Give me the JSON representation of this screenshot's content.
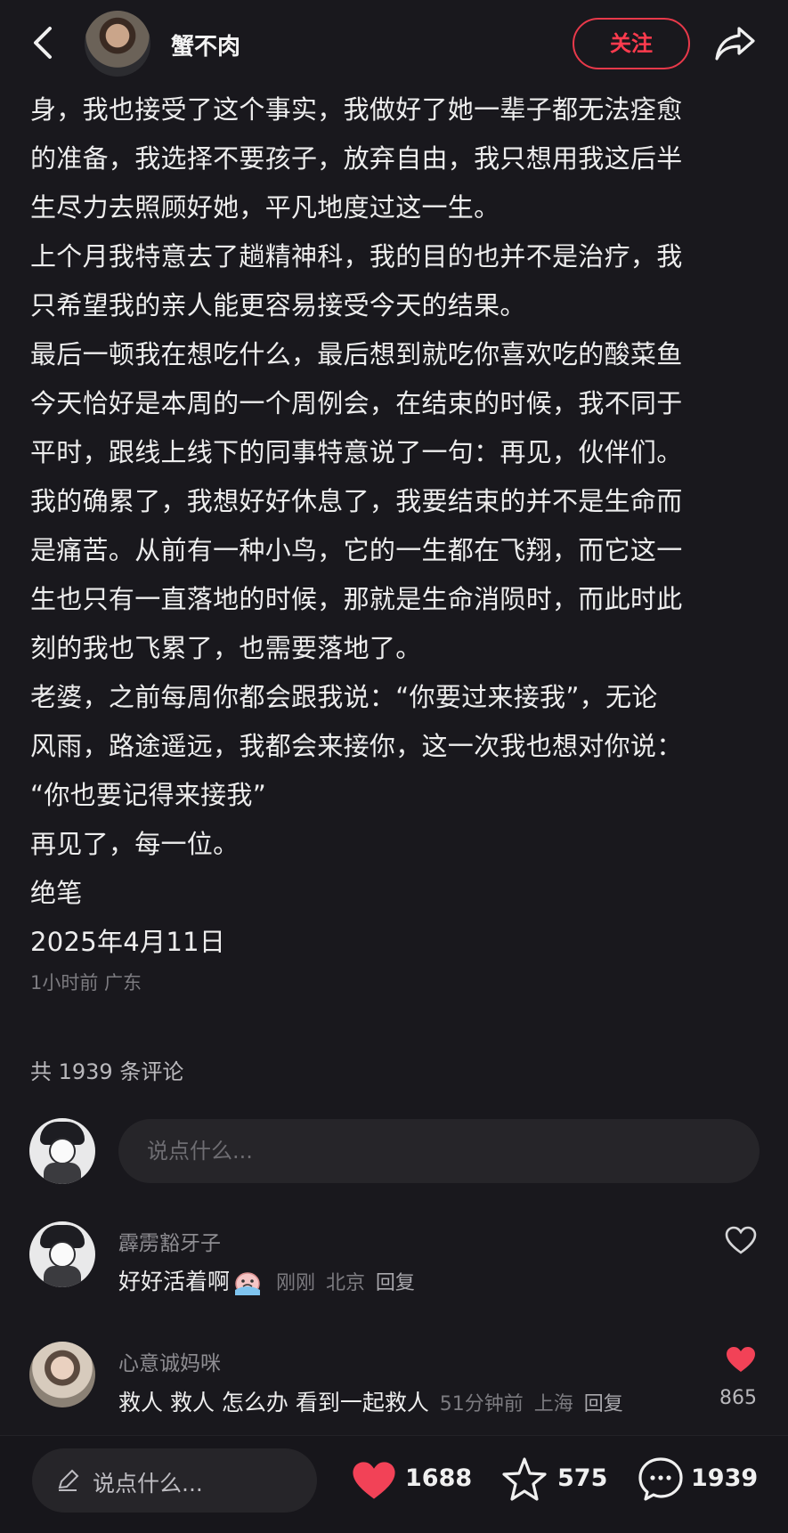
{
  "header": {
    "author": "蟹不肉",
    "follow_label": "关注"
  },
  "post": {
    "lines": [
      "身，我也接受了这个事实，我做好了她一辈子都无法痊愈",
      "的准备，我选择不要孩子，放弃自由，我只想用我这后半",
      "生尽力去照顾好她，平凡地度过这一生。",
      "上个月我特意去了趟精神科，我的目的也并不是治疗，我",
      "只希望我的亲人能更容易接受今天的结果。",
      "最后一顿我在想吃什么，最后想到就吃你喜欢吃的酸菜鱼",
      "今天恰好是本周的一个周例会，在结束的时候，我不同于",
      "平时，跟线上线下的同事特意说了一句：再见，伙伴们。",
      "我的确累了，我想好好休息了，我要结束的并不是生命而",
      "是痛苦。从前有一种小鸟，它的一生都在飞翔，而它这一",
      "生也只有一直落地的时候，那就是生命消陨时，而此时此",
      "刻的我也飞累了，也需要落地了。",
      "老婆，之前每周你都会跟我说：“你要过来接我”，无论",
      "风雨，路途遥远，我都会来接你，这一次我也想对你说：",
      "“你也要记得来接我”",
      "再见了，每一位。",
      "绝笔",
      "2025年4月11日"
    ],
    "meta": "1小时前 广东"
  },
  "comments_count": "共 1939 条评论",
  "composer_placeholder": "说点什么...",
  "comments": [
    {
      "name": "霹雳豁牙子",
      "text": "好好活着啊",
      "emoji": "crying-face",
      "time": "刚刚",
      "location": "北京",
      "reply": "回复",
      "liked": false,
      "likes": ""
    },
    {
      "name": "心意诚妈咪",
      "text": "救人 救人 怎么办 看到一起救人",
      "time": "51分钟前",
      "location": "上海",
      "reply": "回复",
      "liked": true,
      "likes": "865"
    }
  ],
  "bottom": {
    "input_placeholder": "说点什么...",
    "likes": "1688",
    "stars": "575",
    "comments": "1939"
  },
  "colors": {
    "background": "#19181d",
    "accent_red": "#ff3b4e",
    "heart_red": "#f24257"
  }
}
